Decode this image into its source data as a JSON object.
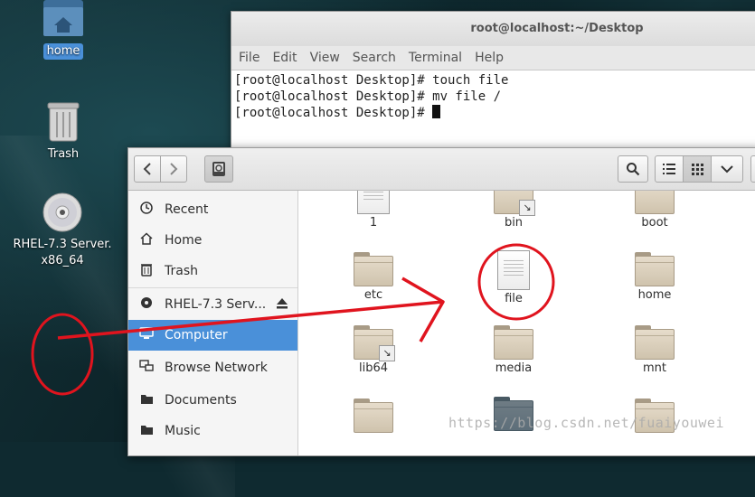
{
  "desktop": {
    "icons": [
      {
        "label": "home",
        "icon": "home-folder-icon"
      },
      {
        "label": "Trash",
        "icon": "trash-icon"
      },
      {
        "label": "RHEL-7.3 Server.\nx86_64",
        "line1": "RHEL-7.3 Server.",
        "line2": "x86_64",
        "icon": "disc-icon"
      }
    ]
  },
  "terminal": {
    "title": "root@localhost:~/Desktop",
    "menu": [
      "File",
      "Edit",
      "View",
      "Search",
      "Terminal",
      "Help"
    ],
    "lines": [
      "[root@localhost Desktop]# touch file",
      "[root@localhost Desktop]# mv file /",
      "[root@localhost Desktop]# "
    ]
  },
  "file_manager": {
    "sidebar": [
      {
        "label": "Recent",
        "icon": "clock-icon"
      },
      {
        "label": "Home",
        "icon": "home-icon"
      },
      {
        "label": "Trash",
        "icon": "trash-icon"
      },
      {
        "label": "RHEL-7.3 Serv...",
        "icon": "disc-icon"
      },
      {
        "label": "Computer",
        "icon": "computer-icon",
        "active": true
      },
      {
        "label": "Browse Network",
        "icon": "network-icon"
      },
      {
        "label": "Documents",
        "icon": "folder-icon"
      },
      {
        "label": "Music",
        "icon": "music-icon"
      }
    ],
    "files": [
      {
        "name": "1",
        "type": "document"
      },
      {
        "name": "bin",
        "type": "folder-link"
      },
      {
        "name": "boot",
        "type": "folder"
      },
      {
        "name": "etc",
        "type": "folder"
      },
      {
        "name": "file",
        "type": "document"
      },
      {
        "name": "home",
        "type": "folder"
      },
      {
        "name": "lib64",
        "type": "folder-link"
      },
      {
        "name": "media",
        "type": "folder"
      },
      {
        "name": "mnt",
        "type": "folder"
      }
    ]
  },
  "watermark": "https://blog.csdn.net/fuaiyouwei",
  "colors": {
    "accent": "#4a90d9",
    "annotation": "#e0141e"
  }
}
